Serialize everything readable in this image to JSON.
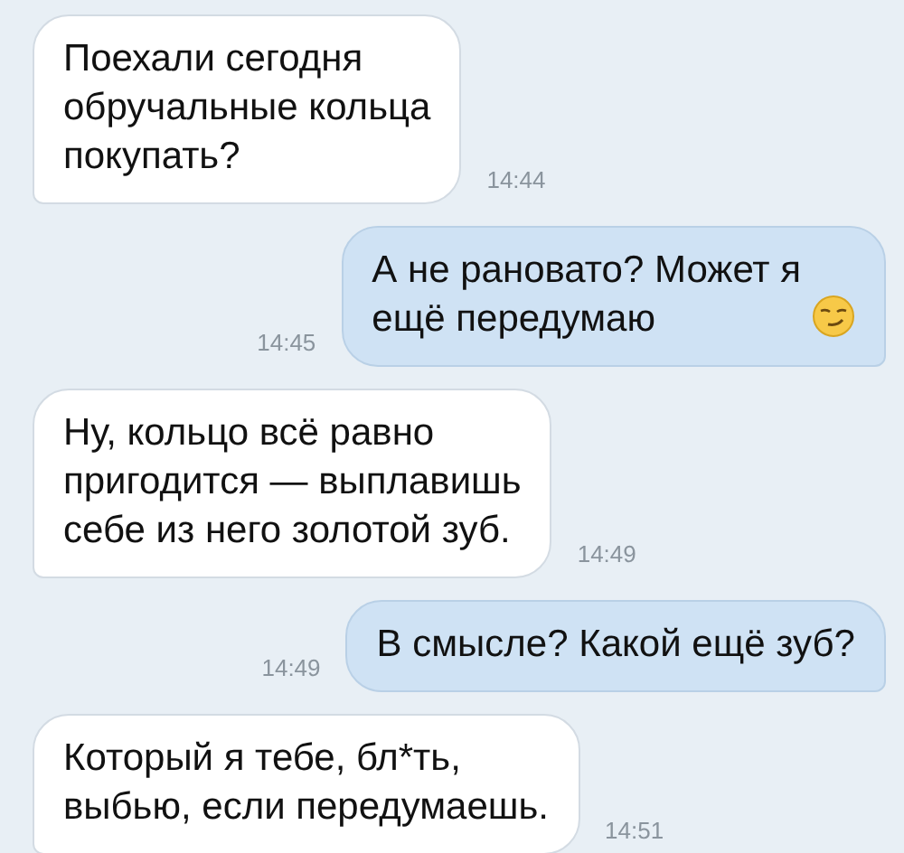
{
  "messages": [
    {
      "kind": "incoming",
      "text": "Поехали сегодня\nобручальные кольца\nпокупать?",
      "time": "14:44"
    },
    {
      "kind": "outgoing",
      "text": "А не рановато? Может я\nещё передумаю",
      "time": "14:45",
      "emoji": true
    },
    {
      "kind": "incoming",
      "text": "Ну, кольцо всё равно\nпригодится — выплавишь\nсебе из него золотой зуб.",
      "time": "14:49"
    },
    {
      "kind": "outgoing",
      "text": "В смысле? Какой ещё зуб?",
      "time": "14:49"
    },
    {
      "kind": "incoming",
      "text": "Который я тебе, бл*ть,\nвыбью, если передумаешь.",
      "time": "14:51"
    }
  ]
}
